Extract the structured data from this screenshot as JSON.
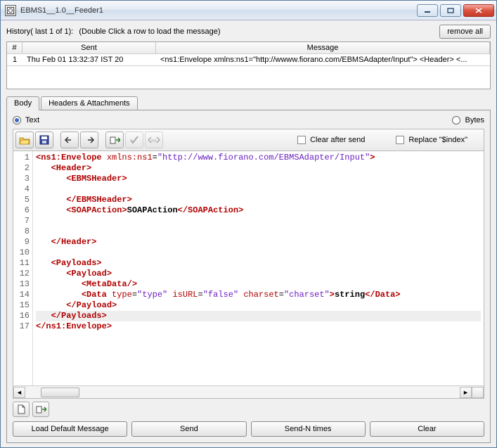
{
  "window": {
    "title": "EBMS1__1.0__Feeder1"
  },
  "history": {
    "label": "History( last 1 of 1):",
    "hint": "(Double Click a row to load the message)",
    "remove_all": "remove all",
    "columns": {
      "num": "#",
      "sent": "Sent",
      "message": "Message"
    },
    "rows": [
      {
        "num": "1",
        "sent": "Thu Feb 01 13:32:37 IST 20",
        "message": "<ns1:Envelope xmlns:ns1=\"http://wwww.fiorano.com/EBMSAdapter/Input\">   <Header>    <..."
      }
    ]
  },
  "tabs": {
    "body": "Body",
    "headers": "Headers & Attachments"
  },
  "radio": {
    "text": "Text",
    "bytes": "Bytes"
  },
  "toolbar": {
    "clear_after_send": "Clear after send",
    "replace_index": "Replace \"$index\""
  },
  "editor_lines": [
    "<ns1:Envelope xmlns:ns1=\"http://www.fiorano.com/EBMSAdapter/Input\">",
    "   <Header>",
    "      <EBMSHeader>",
    "",
    "      </EBMSHeader>",
    "      <SOAPAction>SOAPAction</SOAPAction>",
    "",
    "",
    "   </Header>",
    "",
    "   <Payloads>",
    "      <Payload>",
    "         <MetaData/>",
    "         <Data type=\"type\" isURL=\"false\" charset=\"charset\">string</Data>",
    "      </Payload>",
    "   </Payloads>",
    "</ns1:Envelope>"
  ],
  "buttons": {
    "load_default": "Load Default Message",
    "send": "Send",
    "send_n": "Send-N times",
    "clear": "Clear"
  }
}
